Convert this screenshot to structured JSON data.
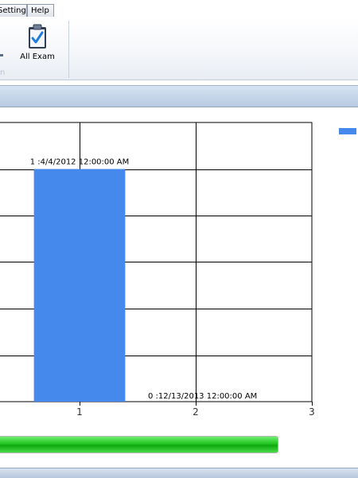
{
  "menu": {
    "tabs": [
      {
        "label": "Setting"
      },
      {
        "label": "Help"
      }
    ]
  },
  "ribbon": {
    "buttons": [
      {
        "label": "All Exam",
        "icon": "clipboard-check-icon"
      }
    ],
    "group_caption_fragment": "n"
  },
  "chart_data": {
    "type": "bar",
    "x": [
      1,
      0.5
    ],
    "values": [
      1,
      0
    ],
    "data_labels": [
      "1 :4/4/2012 12:00:00 AM",
      "0 :12/13/2013 12:00:00 AM"
    ],
    "xticks": [
      "1",
      "2",
      "3"
    ],
    "xlim": [
      0,
      3
    ],
    "ylim": [
      0,
      1.2
    ],
    "grid": true,
    "series_color": "#4589ec",
    "legend": {
      "position": "top-right",
      "color": "#4589ec"
    }
  },
  "progress": {
    "value": 1.0,
    "color": "#22c422"
  },
  "colors": {
    "header_bar": "#c4d5ea",
    "accent": "#4589ec"
  }
}
